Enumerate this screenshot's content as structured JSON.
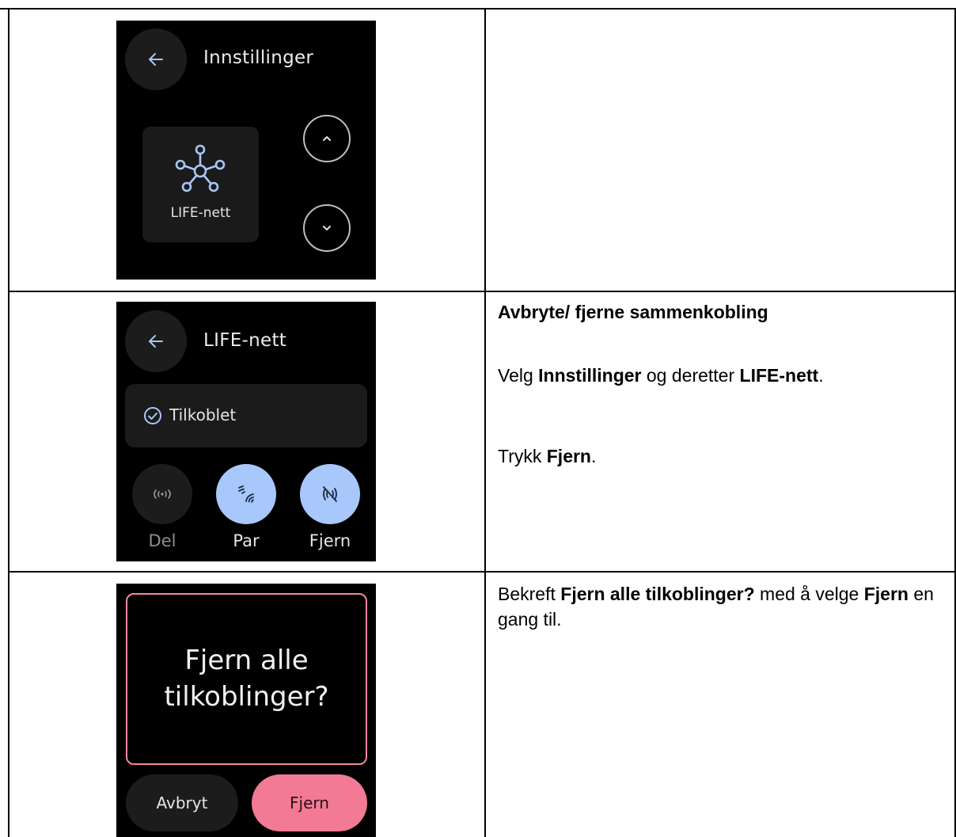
{
  "screens": {
    "settings": {
      "title": "Innstillinger",
      "tile_label": "LIFE-nett",
      "icons": {
        "back": "arrow-left-icon",
        "tile": "network-hub-icon",
        "up": "chevron-up-icon",
        "down": "chevron-down-icon"
      }
    },
    "life_net": {
      "title": "LIFE-nett",
      "status": "Tilkoblet",
      "actions": [
        {
          "label": "Del",
          "icon": "broadcast-icon",
          "active": false
        },
        {
          "label": "Par",
          "icon": "nfc-pair-icon",
          "active": true
        },
        {
          "label": "Fjern",
          "icon": "nfc-off-icon",
          "active": true
        }
      ]
    },
    "confirm": {
      "question": "Fjern alle tilkoblinger?",
      "cancel": "Avbryt",
      "confirm": "Fjern"
    }
  },
  "instructions": {
    "heading": "Avbryte/ fjerne sammenkobling",
    "step1": {
      "pre": "Velg ",
      "b1": "Innstillinger",
      "mid": " og deretter ",
      "b2": "LIFE-nett",
      "post": "."
    },
    "step2": {
      "pre": "Trykk ",
      "b1": "Fjern",
      "post": "."
    },
    "step3": {
      "pre": "Bekreft ",
      "b1": "Fjern alle tilkoblinger?",
      "mid": " med å velge ",
      "b2": "Fjern",
      "post": " en gang til."
    }
  },
  "colors": {
    "accent_blue": "#a8c7fa",
    "accent_pink": "#f27a94",
    "dialog_border": "#f3889f"
  }
}
